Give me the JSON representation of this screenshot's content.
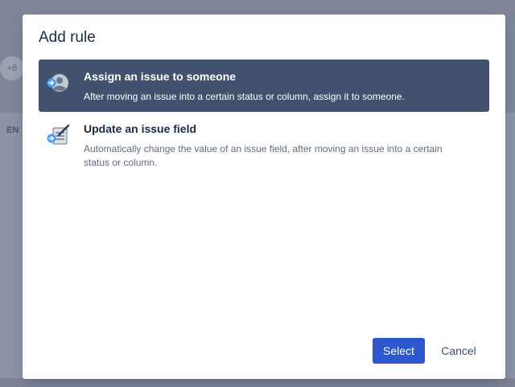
{
  "background": {
    "avatar_count": "+6",
    "side_label": "EN"
  },
  "modal": {
    "title": "Add rule",
    "options": [
      {
        "title": "Assign an issue to someone",
        "description": "After moving an issue into a certain status or column, assign it to someone.",
        "icon": "assign-user-icon",
        "selected": true
      },
      {
        "title": "Update an issue field",
        "description": "Automatically change the value of an issue field, after moving an issue into a certain status or column.",
        "icon": "update-field-icon",
        "selected": false
      }
    ],
    "buttons": {
      "select_label": "Select",
      "cancel_label": "Cancel"
    }
  },
  "colors": {
    "accent": "#2d57cf",
    "selected_row": "#42526e",
    "text": "#172b4d",
    "muted": "#5e6c84"
  }
}
